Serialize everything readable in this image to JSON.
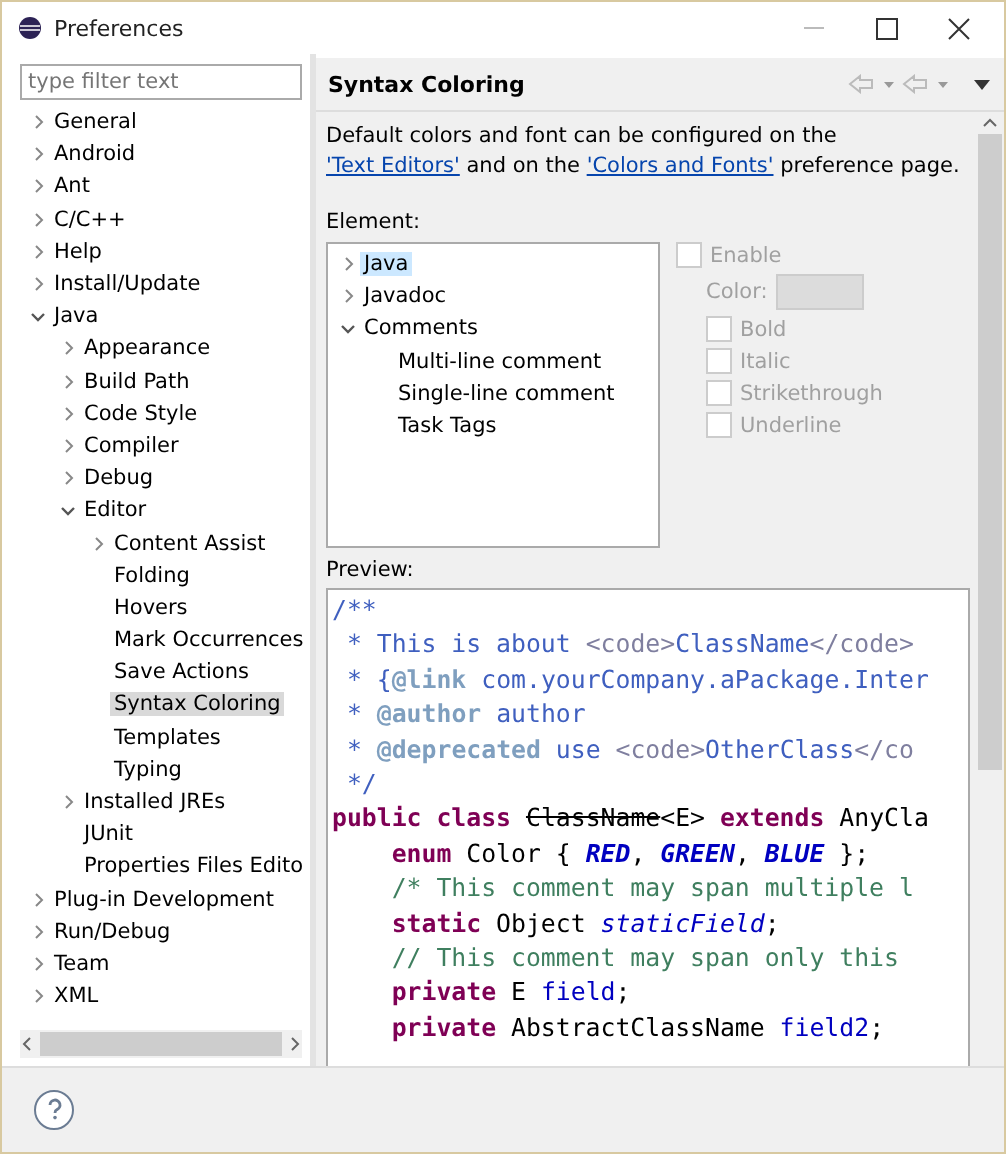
{
  "window": {
    "title": "Preferences"
  },
  "filter": {
    "placeholder": "type filter text"
  },
  "nav_tree": [
    {
      "label": "General",
      "kind": "collapsed",
      "selected": false
    },
    {
      "label": "Android",
      "kind": "collapsed",
      "selected": false
    },
    {
      "label": "Ant",
      "kind": "collapsed",
      "selected": false
    },
    {
      "label": "C/C++",
      "kind": "collapsed",
      "selected": false
    },
    {
      "label": "Help",
      "kind": "collapsed",
      "selected": false
    },
    {
      "label": "Install/Update",
      "kind": "collapsed",
      "selected": false
    },
    {
      "label": "Java",
      "kind": "expanded",
      "selected": false,
      "children": [
        {
          "label": "Appearance",
          "kind": "collapsed",
          "selected": false
        },
        {
          "label": "Build Path",
          "kind": "collapsed",
          "selected": false
        },
        {
          "label": "Code Style",
          "kind": "collapsed",
          "selected": false
        },
        {
          "label": "Compiler",
          "kind": "collapsed",
          "selected": false
        },
        {
          "label": "Debug",
          "kind": "collapsed",
          "selected": false
        },
        {
          "label": "Editor",
          "kind": "expanded",
          "selected": false,
          "children": [
            {
              "label": "Content Assist",
              "kind": "collapsed",
              "selected": false
            },
            {
              "label": "Folding",
              "kind": "leaf",
              "selected": false
            },
            {
              "label": "Hovers",
              "kind": "leaf",
              "selected": false
            },
            {
              "label": "Mark Occurrences",
              "kind": "leaf",
              "selected": false
            },
            {
              "label": "Save Actions",
              "kind": "leaf",
              "selected": false
            },
            {
              "label": "Syntax Coloring",
              "kind": "leaf",
              "selected": true
            },
            {
              "label": "Templates",
              "kind": "leaf",
              "selected": false
            },
            {
              "label": "Typing",
              "kind": "leaf",
              "selected": false
            }
          ]
        },
        {
          "label": "Installed JREs",
          "kind": "collapsed",
          "selected": false
        },
        {
          "label": "JUnit",
          "kind": "leaf",
          "selected": false
        },
        {
          "label": "Properties Files Edito",
          "kind": "leaf",
          "selected": false
        }
      ]
    },
    {
      "label": "Plug-in Development",
      "kind": "collapsed",
      "selected": false
    },
    {
      "label": "Run/Debug",
      "kind": "collapsed",
      "selected": false
    },
    {
      "label": "Team",
      "kind": "collapsed",
      "selected": false
    },
    {
      "label": "XML",
      "kind": "collapsed",
      "selected": false
    }
  ],
  "page": {
    "title": "Syntax Coloring",
    "description": [
      {
        "kind": "text",
        "text": "Default colors and font can be configured on the "
      },
      {
        "kind": "link",
        "text": "'Text Editors'"
      },
      {
        "kind": "text",
        "text": " and on the "
      },
      {
        "kind": "link",
        "text": "'Colors and Fonts'"
      },
      {
        "kind": "text",
        "text": " preference page."
      }
    ],
    "element_label": "Element:",
    "element_tree": [
      {
        "label": "Java",
        "kind": "collapsed",
        "selected": true
      },
      {
        "label": "Javadoc",
        "kind": "collapsed",
        "selected": false
      },
      {
        "label": "Comments",
        "kind": "expanded",
        "selected": false,
        "children": [
          {
            "label": "Multi-line comment",
            "kind": "leaf",
            "selected": false
          },
          {
            "label": "Single-line comment",
            "kind": "leaf",
            "selected": false
          },
          {
            "label": "Task Tags",
            "kind": "leaf",
            "selected": false
          }
        ]
      }
    ],
    "enable": {
      "label": "Enable",
      "checked": false,
      "disabled": true
    },
    "color_label": "Color:",
    "styles": [
      {
        "label": "Bold",
        "checked": false,
        "disabled": true
      },
      {
        "label": "Italic",
        "checked": false,
        "disabled": true
      },
      {
        "label": "Strikethrough",
        "checked": false,
        "disabled": true
      },
      {
        "label": "Underline",
        "checked": false,
        "disabled": true
      }
    ],
    "preview_label": "Preview:",
    "preview": [
      [
        {
          "kind": "javadoc",
          "text": "/**"
        }
      ],
      [
        {
          "kind": "javadoc",
          "text": " * This is about "
        },
        {
          "kind": "html",
          "text": "<code>"
        },
        {
          "kind": "javadoc",
          "text": "ClassName"
        },
        {
          "kind": "html",
          "text": "</code>"
        }
      ],
      [
        {
          "kind": "javadoc",
          "text": " * {"
        },
        {
          "kind": "javadoc_tag",
          "text": "@link"
        },
        {
          "kind": "javadoc",
          "text": " com.yourCompany.aPackage.Inter"
        }
      ],
      [
        {
          "kind": "javadoc",
          "text": " * "
        },
        {
          "kind": "javadoc_tag",
          "text": "@author"
        },
        {
          "kind": "javadoc",
          "text": " author"
        }
      ],
      [
        {
          "kind": "javadoc",
          "text": " * "
        },
        {
          "kind": "javadoc_tag",
          "text": "@deprecated"
        },
        {
          "kind": "javadoc",
          "text": " use "
        },
        {
          "kind": "html",
          "text": "<code>"
        },
        {
          "kind": "javadoc",
          "text": "OtherClass"
        },
        {
          "kind": "html",
          "text": "</co"
        }
      ],
      [
        {
          "kind": "javadoc",
          "text": " */"
        }
      ],
      [
        {
          "kind": "keyword",
          "text": "public class "
        },
        {
          "kind": "deprecated",
          "text": "ClassName"
        },
        {
          "kind": "plain",
          "text": "<E> "
        },
        {
          "kind": "keyword",
          "text": "extends"
        },
        {
          "kind": "plain",
          "text": " AnyCla"
        }
      ],
      [
        {
          "kind": "keyword",
          "text": "enum"
        },
        {
          "kind": "plain",
          "text": " Color { "
        },
        {
          "kind": "enum_constant",
          "text": "RED"
        },
        {
          "kind": "plain",
          "text": ", "
        },
        {
          "kind": "enum_constant",
          "text": "GREEN"
        },
        {
          "kind": "plain",
          "text": ", "
        },
        {
          "kind": "enum_constant",
          "text": "BLUE"
        },
        {
          "kind": "plain",
          "text": " };"
        }
      ],
      [
        {
          "kind": "comment",
          "text": "/* This comment may span multiple l"
        }
      ],
      [
        {
          "kind": "keyword",
          "text": "static"
        },
        {
          "kind": "plain",
          "text": " Object "
        },
        {
          "kind": "static_field",
          "text": "staticField"
        },
        {
          "kind": "plain",
          "text": ";"
        }
      ],
      [
        {
          "kind": "comment",
          "text": "// This comment may span only this"
        }
      ],
      [
        {
          "kind": "keyword",
          "text": "private"
        },
        {
          "kind": "plain",
          "text": " E "
        },
        {
          "kind": "field",
          "text": "field"
        },
        {
          "kind": "plain",
          "text": ";"
        }
      ],
      [
        {
          "kind": "keyword",
          "text": "private"
        },
        {
          "kind": "plain",
          "text": " AbstractClassName "
        },
        {
          "kind": "field",
          "text": "field2"
        },
        {
          "kind": "plain",
          "text": ";"
        }
      ]
    ]
  }
}
